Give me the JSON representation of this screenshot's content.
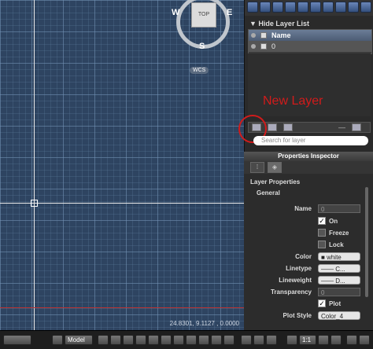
{
  "viewcube": {
    "top_label": "TOP",
    "north": "",
    "south": "S",
    "west": "W",
    "east": "E",
    "wcs_label": "WCS"
  },
  "canvas": {
    "coordinates": "24.8301, 9.1127 , 0.0000"
  },
  "layers": {
    "header": "Hide Layer List",
    "column_name": "Name",
    "rows": [
      {
        "name": "0"
      }
    ],
    "search_placeholder": "Search for layer"
  },
  "annotation": {
    "text": "New Layer",
    "color": "#d21b1b"
  },
  "properties_inspector": {
    "title": "Properties Inspector",
    "section": "Layer Properties",
    "subsection": "General",
    "fields": {
      "name_label": "Name",
      "name_value": "0",
      "on_label": "On",
      "freeze_label": "Freeze",
      "lock_label": "Lock",
      "color_label": "Color",
      "color_value": "white",
      "linetype_label": "Linetype",
      "linetype_value": "C...",
      "lineweight_label": "Lineweight",
      "lineweight_value": "D...",
      "transparency_label": "Transparency",
      "transparency_value": "0",
      "plot_label": "Plot",
      "plot_style_label": "Plot Style",
      "plot_style_value": "Color_4"
    }
  },
  "statusbar": {
    "model_label": "Model",
    "scale_label": "1:1"
  }
}
